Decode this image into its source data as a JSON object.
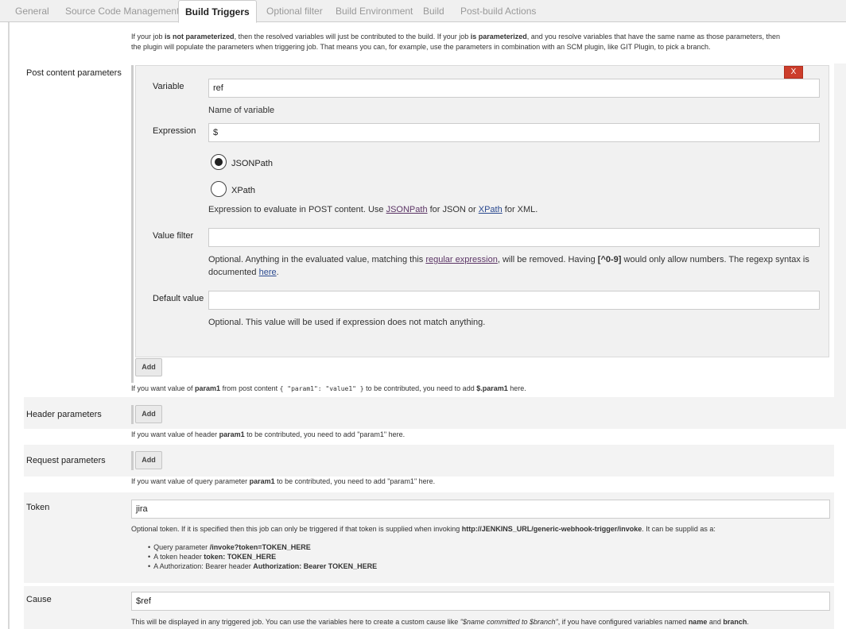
{
  "tabs": [
    {
      "label": "General"
    },
    {
      "label": "Source Code Management"
    },
    {
      "label": "Build Triggers"
    },
    {
      "label": "Optional filter"
    },
    {
      "label": "Build Environment"
    },
    {
      "label": "Build"
    },
    {
      "label": "Post-build Actions"
    }
  ],
  "intro": {
    "p1a": "If your job ",
    "p1b": "is not parameterized",
    "p1c": ", then the resolved variables will just be contributed to the build. If your job ",
    "p1d": "is parameterized",
    "p1e": ", and you resolve variables that have the same name as those parameters, then",
    "p2": "the plugin will populate the parameters when triggering job. That means you can, for example, use the parameters in combination with an SCM plugin, like GIT Plugin, to pick a branch."
  },
  "post_content": {
    "label": "Post content parameters",
    "delete_label": "X",
    "variable_label": "Variable",
    "variable_value": "ref",
    "variable_help": "Name of variable",
    "expression_label": "Expression",
    "expression_value": "$",
    "radio_jsonpath": "JSONPath",
    "radio_xpath": "XPath",
    "expr_help_a": "Expression to evaluate in POST content. Use ",
    "expr_help_link1": "JSONPath",
    "expr_help_b": " for JSON or ",
    "expr_help_link2": "XPath",
    "expr_help_c": " for XML.",
    "value_filter_label": "Value filter",
    "value_filter_value": "",
    "vf_help_a": "Optional. Anything in the evaluated value, matching this ",
    "vf_help_link": "regular expression",
    "vf_help_b": ", will be removed. Having ",
    "vf_help_code": "[^0-9]",
    "vf_help_c": " would only allow numbers. The regexp syntax is",
    "vf_help_d": "documented ",
    "vf_help_link2": "here",
    "vf_help_e": ".",
    "default_label": "Default value",
    "default_value": "",
    "default_help": "Optional. This value will be used if expression does not match anything.",
    "add_label": "Add",
    "desc_a": "If you want value of ",
    "desc_b": "param1",
    "desc_c": " from post content ",
    "desc_code": "{ \"param1\": \"value1\" }",
    "desc_d": " to be contributed, you need to add ",
    "desc_e": "$.param1",
    "desc_f": " here."
  },
  "header_params": {
    "label": "Header parameters",
    "add_label": "Add",
    "desc_a": "If you want value of header ",
    "desc_b": "param1",
    "desc_c": " to be contributed, you need to add \"param1\" here."
  },
  "request_params": {
    "label": "Request parameters",
    "add_label": "Add",
    "desc_a": "If you want value of query parameter ",
    "desc_b": "param1",
    "desc_c": " to be contributed, you need to add \"param1\" here."
  },
  "token": {
    "label": "Token",
    "value": "jira",
    "desc_a": "Optional token. If it is specified then this job can only be triggered if that token is supplied when invoking ",
    "desc_b": "http://JENKINS_URL/generic-webhook-trigger/invoke",
    "desc_c": ". It can be supplid as a:",
    "bullets": [
      {
        "a": "Query parameter ",
        "b": "/invoke?token=TOKEN_HERE"
      },
      {
        "a": "A token header ",
        "b": "token: TOKEN_HERE"
      },
      {
        "a": "A Authorization: Bearer header ",
        "b": "Authorization: Bearer TOKEN_HERE"
      }
    ]
  },
  "cause": {
    "label": "Cause",
    "value": "$ref",
    "desc_a": "This will be displayed in any triggered job. You can use the variables here to create a custom cause like ",
    "desc_b": "\"$name committed to $branch\"",
    "desc_c": ", if you have configured variables named ",
    "desc_d": "name",
    "desc_e": " and ",
    "desc_f": "branch",
    "desc_g": "."
  }
}
